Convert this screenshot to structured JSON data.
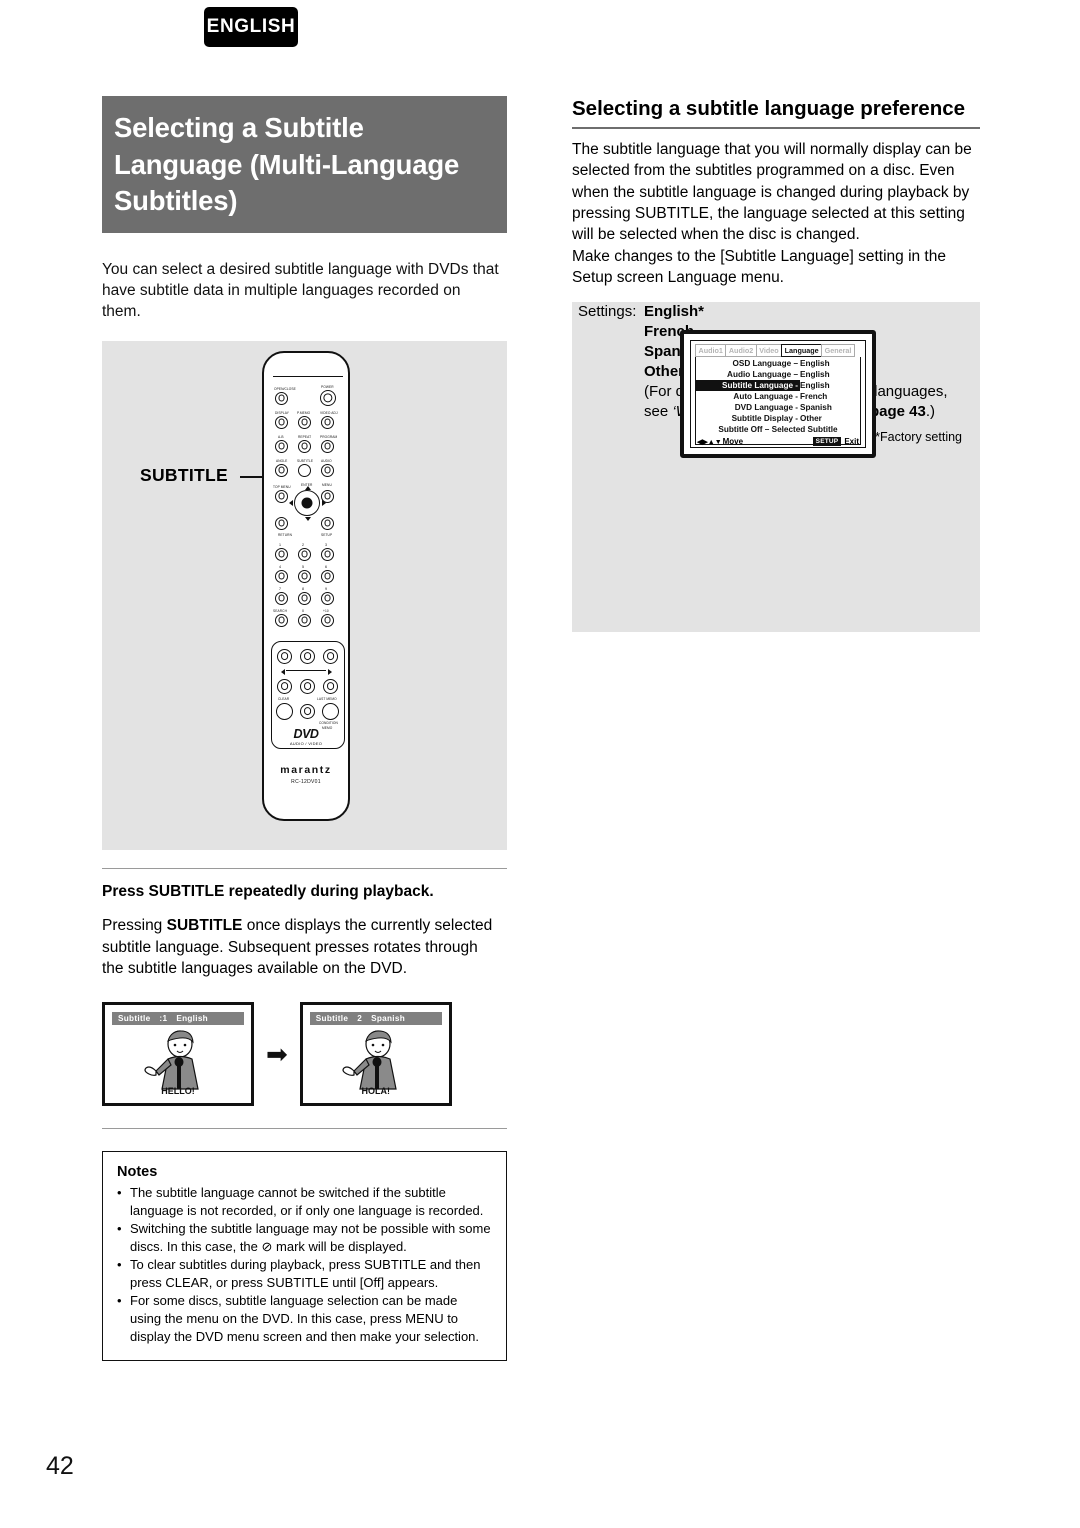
{
  "page": {
    "language_tag": "ENGLISH",
    "page_number": "42"
  },
  "left": {
    "heading": "Selecting a Subtitle Language (Multi-Language Subtitles)",
    "intro": "You can select a desired subtitle language with DVDs that have subtitle data in multiple languages recorded on them.",
    "remote": {
      "callout_label": "SUBTITLE",
      "brand": "marantz",
      "model": "RC-12DV01",
      "logo": "DVD",
      "logo_sub": "AUDIO / VIDEO",
      "buttons": [
        "OPEN/CLOSE",
        "POWER",
        "DISPLAY",
        "P.MEMO",
        "VIDEO ADJ",
        "A-B",
        "REPEAT",
        "PROGRAM",
        "ANGLE",
        "SUBTITLE",
        "AUDIO",
        "TOP MENU",
        "ENTER",
        "MENU",
        "RETURN",
        "SETUP",
        "1",
        "2",
        "3",
        "4",
        "5",
        "6",
        "7",
        "8",
        "9",
        "SEARCH",
        "0",
        "+10",
        "CLEAR",
        "LAST MEMO",
        "CONDITION MEMO"
      ]
    },
    "press_heading": "Press SUBTITLE repeatedly during playback.",
    "press_body_pre": "Pressing ",
    "press_body_bold": "SUBTITLE",
    "press_body_post": " once displays the currently selected subtitle language. Subsequent presses rotates through the subtitle languages available on the DVD.",
    "tv_examples": [
      {
        "bar_label": "Subtitle",
        "bar_index": ":1",
        "bar_language": "English",
        "caption": "HELLO!"
      },
      {
        "bar_label": "Subtitle",
        "bar_index": "2",
        "bar_language": "Spanish",
        "caption": "HOLA!"
      }
    ],
    "arrow": "➡",
    "notes": {
      "title": "Notes",
      "items": [
        "The subtitle language cannot be switched if the subtitle language is not recorded, or if only one language is recorded.",
        "Switching the subtitle language may not be possible with some discs. In this case, the ⊘ mark will be displayed.",
        "To clear subtitles during playback, press SUBTITLE and then press CLEAR, or press SUBTITLE until [Off] appears.",
        "For some discs, subtitle language selection can be made using the menu on the DVD. In this case, press MENU to display the DVD menu screen and then make your selection."
      ]
    }
  },
  "right": {
    "heading": "Selecting a subtitle language preference",
    "body": "The subtitle language that you will normally display can be selected from the subtitles programmed on a disc. Even when the subtitle language is changed during playback by pressing SUBTITLE, the language selected at this setting will be selected when the disc is changed.\nMake changes to the [Subtitle Language] setting in the Setup screen Language menu.",
    "osd": {
      "tabs": [
        {
          "label": "Audio1",
          "active": false
        },
        {
          "label": "Audio2",
          "active": false
        },
        {
          "label": "Video",
          "active": false
        },
        {
          "label": "Language",
          "active": true
        },
        {
          "label": "General",
          "active": false
        }
      ],
      "rows": [
        {
          "label": "OSD Language –",
          "value": "English",
          "selected": false
        },
        {
          "label": "Audio Language –",
          "value": "English",
          "selected": false
        },
        {
          "label": "Subtitle Language -",
          "value": "English",
          "selected": true
        },
        {
          "label": "Auto Language -",
          "value": "French",
          "selected": false
        },
        {
          "label": "DVD Language -",
          "value": "Spanish",
          "selected": false
        },
        {
          "label": "Subtitle Display -",
          "value": "Other",
          "selected": false
        }
      ],
      "wide_row": "Subtitle Off – Selected Subtitle",
      "footer_move": "Move",
      "footer_arrows": "◀▶▲▼",
      "footer_setup_chip": "SETUP",
      "footer_exit": "Exit"
    },
    "settings": {
      "label": "Settings:",
      "values": [
        "English*",
        "French",
        "Spanish",
        "Other"
      ],
      "note_pre": "(For details on how to select other languages, see ",
      "note_italic": "‘When “Other” is selected’",
      "note_mid": " on ",
      "note_bold": "page 43",
      "note_post": ".)",
      "factory": "*Factory setting"
    }
  }
}
